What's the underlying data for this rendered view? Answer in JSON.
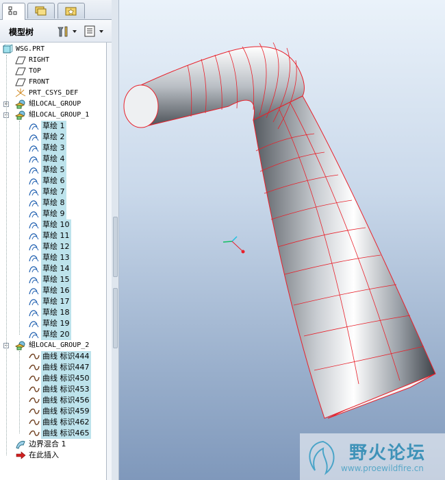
{
  "model_tree": {
    "title": "模型树",
    "root": "WSG.PRT",
    "datums": [
      "RIGHT",
      "TOP",
      "FRONT"
    ],
    "csys": "PRT_CSYS_DEF",
    "group0": "組LOCAL_GROUP",
    "group1": "組LOCAL_GROUP_1",
    "sketches": [
      "草绘 1",
      "草绘 2",
      "草绘 3",
      "草绘 4",
      "草绘 5",
      "草绘 6",
      "草绘 7",
      "草绘 8",
      "草绘 9",
      "草绘 10",
      "草绘 11",
      "草绘 12",
      "草绘 13",
      "草绘 14",
      "草绘 15",
      "草绘 16",
      "草绘 17",
      "草绘 18",
      "草绘 19",
      "草绘 20"
    ],
    "group2": "組LOCAL_GROUP_2",
    "curves": [
      "曲线 标识444",
      "曲线 标识447",
      "曲线 标识450",
      "曲线 标识453",
      "曲线 标识456",
      "曲线 标识459",
      "曲线 标识462",
      "曲线 标识465"
    ],
    "blend": "边界混合 1",
    "insert_here": "在此插入"
  },
  "watermark": {
    "title": "野火论坛",
    "url": "www.proewildfire.cn"
  },
  "colors": {
    "highlight": "#bde3ec",
    "edge": "#e8202a",
    "accent": "#3e92b8"
  }
}
